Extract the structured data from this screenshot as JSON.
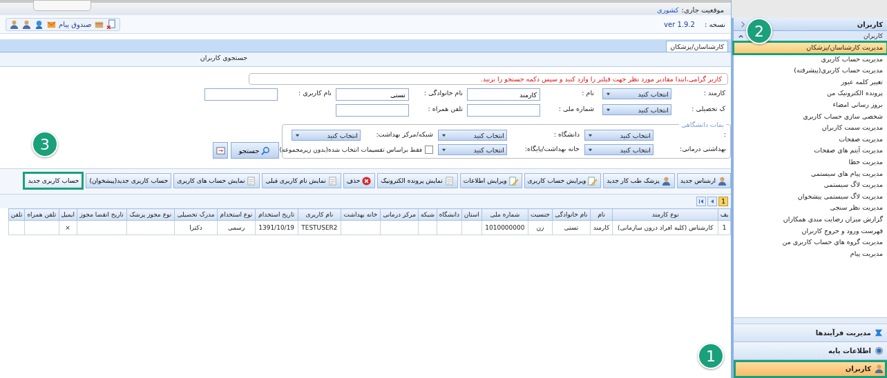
{
  "header": {
    "location_label": "موقعیت جاری:",
    "location": "کشوری"
  },
  "toolbar": {
    "message_box": "صندوق پیام",
    "version_label": "نسخه :",
    "version": "ver 1.9.2"
  },
  "tab": {
    "label": "کارشناسان/پزشکان",
    "selected": true
  },
  "section_title": "جستجوی کاربران",
  "notice": "کاربر گرامی،ابتدا مقادیر مورد نظر جهت فیلتر را وارد کنید و سپس دکمه جستجو را بزنید.",
  "form_rows": [
    [
      {
        "label": "کارمند :",
        "kind": "select",
        "value": "انتخاب کنید"
      },
      {
        "label": "نام :",
        "kind": "text",
        "value": "کارمند"
      },
      {
        "label": "نام خانوادگی :",
        "kind": "text",
        "value": "تستی"
      },
      {
        "label": "نام کاربری :",
        "kind": "text"
      }
    ],
    [
      {
        "label": "ک تحصیلی :",
        "kind": "select",
        "value": "انتخاب کنید"
      },
      {
        "label": "شماره ملی :",
        "kind": "text"
      },
      {
        "label": "تلفن همراه :",
        "kind": "text"
      }
    ]
  ],
  "division_group": {
    "legend": "یمات دانشگاهی",
    "rows": [
      [
        {
          "label": ":",
          "kind": "select",
          "value": "انتخاب کنید"
        },
        {
          "label": "دانشگاه :",
          "kind": "select",
          "value": "انتخاب کنید"
        },
        {
          "label": "شبکه/مرکز بهداشت:",
          "kind": "select",
          "value": "انتخاب کنید"
        }
      ],
      [
        {
          "label": "بهداشتی درمانی:",
          "kind": "select",
          "value": "انتخاب کنید"
        },
        {
          "label": "خانه بهداشت/پایگاه:",
          "kind": "select",
          "value": "انتخاب کنید"
        },
        {
          "label": "فقط براساس تقسیمات انتخاب شده(بدون زیرمجموعه)",
          "kind": "checkbox",
          "checked": false
        }
      ]
    ],
    "search_button": "جستجو"
  },
  "actions": [
    {
      "label": "ارشناس جدید",
      "highlighted": false
    },
    {
      "label": "پزشک طب کار جدید",
      "highlighted": false
    },
    {
      "label": "ویرایش حساب کاربری",
      "highlighted": false
    },
    {
      "label": "ویرایش اطلاعات",
      "highlighted": false
    },
    {
      "label": "نمایش پرونده الکترونیک",
      "highlighted": false
    },
    {
      "label": "حذف",
      "highlighted": false
    },
    {
      "label": "نمایش نام کاربری قبلی",
      "highlighted": false
    },
    {
      "label": "نمایش حساب های کاربری",
      "highlighted": false
    },
    {
      "label": "حساب کاربری جدید(پیشخوان)",
      "highlighted": false
    },
    {
      "label": "حساب کاربری جدید",
      "highlighted": true
    }
  ],
  "pager": {
    "pages": [
      {
        "label": "1",
        "selected": true
      }
    ]
  },
  "table": {
    "columns": [
      "یف",
      "نوع کارمند",
      "نام",
      "نام خانوادگی",
      "جنسیت",
      "شماره ملی",
      "استان",
      "دانشگاه",
      "شبکه",
      "مرکز درمانی",
      "خانه بهداشت",
      "نام کاربری",
      "تاریخ استخدام",
      "نوع استخدام",
      "مدرک تحصیلی",
      "نوع مجوز پزشک",
      "تاریخ انقضا مجوز",
      "ایمیل",
      "تلفن همراه",
      "تلفن"
    ],
    "rows": [
      [
        "1",
        "کارشناس (کلیه افراد درون سازمانی)",
        "کارمند",
        "تستی",
        "زن",
        "1010000000",
        null,
        null,
        null,
        null,
        null,
        "TESTUSER2",
        "1391/10/19",
        "رسمی",
        "دکترا",
        null,
        null,
        "×",
        null,
        null
      ]
    ]
  },
  "sidebar": {
    "title": "کاربران",
    "group": "کاربران",
    "items": [
      {
        "label": "مدیریت کارشناسان/پزشکان",
        "selected": true
      },
      {
        "label": "مدیریت حساب کاربری",
        "selected": false
      },
      {
        "label": "مدیریت حساب کاربری(پیشرفته)",
        "selected": false
      },
      {
        "label": "تغییر کلمه عبور",
        "selected": false
      },
      {
        "label": "پرونده الکترونیک من",
        "selected": false
      },
      {
        "label": "بروز رسانی امضاء",
        "selected": false
      },
      {
        "label": "شخصی سازی حساب کاربری",
        "selected": false
      },
      {
        "label": "مدیریت سمت کاربران",
        "selected": false
      },
      {
        "label": "مدیریت صفحات",
        "selected": false
      },
      {
        "label": "مدیریت آیتم های صفحات",
        "selected": false
      },
      {
        "label": "مدیریت خطا",
        "selected": false
      },
      {
        "label": "مدیریت پیام های سیستمی",
        "selected": false
      },
      {
        "label": "مدیریت لاگ سیستمی",
        "selected": false
      },
      {
        "label": "مدیریت لاگ سیستمی پیشخوان",
        "selected": false
      },
      {
        "label": "مدیریت نظر سنجی",
        "selected": false
      },
      {
        "label": "گزارش میزان رضایت مندی همکاران",
        "selected": false
      },
      {
        "label": "فهرست ورود و خروج کاربران",
        "selected": false
      },
      {
        "label": "مدیریت گروه های حساب کاربری من",
        "selected": false
      },
      {
        "label": "مدیریت پیام",
        "selected": false
      }
    ],
    "nav": [
      {
        "label": "مدیریت فرآیندها",
        "selected": false
      },
      {
        "label": "اطلاعات پایه",
        "selected": false
      },
      {
        "label": "کاربران",
        "selected": true
      }
    ]
  },
  "callouts": [
    "1",
    "2",
    "3"
  ]
}
